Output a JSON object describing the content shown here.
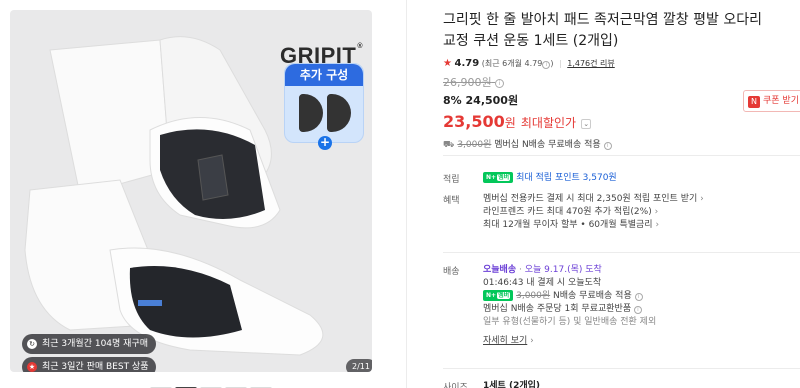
{
  "gallery": {
    "brand": "GRIPIT",
    "brand_mark": "®",
    "addon_tag": "추가 구성",
    "addon_plus": "+",
    "badges": [
      {
        "icon": "repurchase-icon",
        "text": "최근 3개월간 104명 재구매"
      },
      {
        "icon": "best-icon",
        "text": "최근 3일간 판매 BEST 상품"
      }
    ],
    "pager": "2/11"
  },
  "product": {
    "title": "그리핏 한 줄 발아치 패드 족저근막염 깔창 평발 오다리 교정 쿠션 운동 1세트 (2개입)",
    "rating": {
      "star": "★",
      "score": "4.79",
      "detail": "(최근 6개월 4.79",
      "detail_end": ")",
      "reviews": "1,476건 리뷰"
    },
    "original_price": "26,900원",
    "sale_line": "8% 24,500원",
    "max_price": "23,500",
    "max_price_unit": "원",
    "max_label": "최대할인가",
    "coupon_button": "쿠폰 받기",
    "shipping_note": {
      "strike": "3,000원",
      "text": "멤버십 N배송 무료배송 적용"
    }
  },
  "benefits": {
    "points_label": "적립",
    "points_text": "최대 적립 포인트 3,570원",
    "benefit_label": "혜택",
    "benefit_lines": [
      "멤버십 전용카드 결제 시 최대 2,350원 적립 포인트 받기",
      "라인프렌즈 카드 최대 470원 추가 적립(2%)",
      "최대 12개월 무이자 할부 • 60개월 특별금리"
    ]
  },
  "delivery": {
    "label": "배송",
    "today_chip": "오늘배송",
    "eta": "오늘 9.17.(목) 도착",
    "cutoff": "01:46:43  내 결제 시 오늘도착",
    "npay_strike": "3,000원",
    "npay_text": "N배송 무료배송 적용",
    "return_text": "멤버십 N배송 주문당 1회 무료교환반품",
    "exception_text": "일부 유형(선물하기 등) 및 일반배송 전환 제외",
    "more": "자세히 보기"
  },
  "options": {
    "label": "사이즈",
    "value": "1세트 (2개입)"
  },
  "npay_badge": "N+",
  "npay_member": "멤버"
}
